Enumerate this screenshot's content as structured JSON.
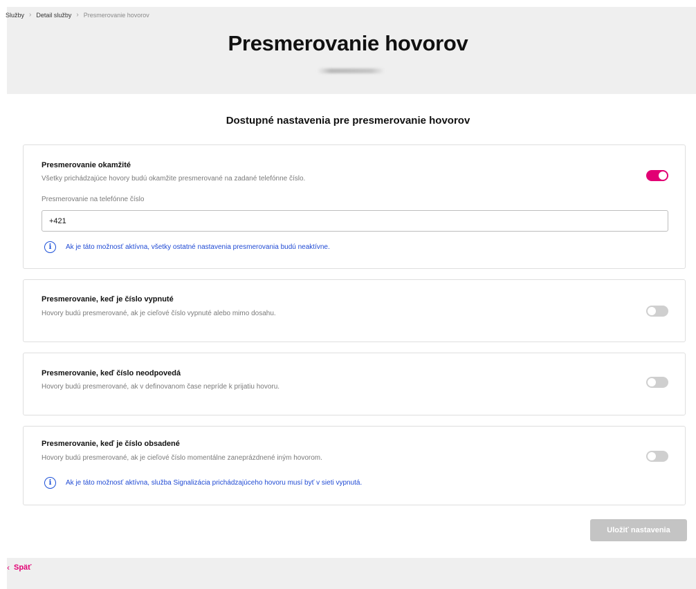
{
  "breadcrumb": {
    "items": [
      "Služby",
      "Detail služby"
    ],
    "current": "Presmerovanie hovorov",
    "separator": "›"
  },
  "page": {
    "title": "Presmerovanie hovorov",
    "section_title": "Dostupné nastavenia pre presmerovanie hovorov"
  },
  "cards": [
    {
      "title": "Presmerovanie okamžité",
      "description": "Všetky prichádzajúce hovory budú okamžite presmerované na zadané telefónne číslo.",
      "enabled": true,
      "field_label": "Presmerovanie na telefónne číslo",
      "field_value": "+421",
      "info": "Ak je táto možnosť aktívna, všetky ostatné nastavenia presmerovania budú neaktívne."
    },
    {
      "title": "Presmerovanie, keď je číslo vypnuté",
      "description": "Hovory budú presmerované, ak je cieľové číslo vypnuté alebo mimo dosahu.",
      "enabled": false
    },
    {
      "title": "Presmerovanie, keď číslo neodpovedá",
      "description": "Hovory budú presmerované, ak v definovanom čase nepríde k prijatiu hovoru.",
      "enabled": false
    },
    {
      "title": "Presmerovanie, keď je číslo obsadené",
      "description": "Hovory budú presmerované, ak je cieľové číslo momentálne zaneprázdnené iným hovorom.",
      "enabled": false,
      "info": "Ak je táto možnosť aktívna, služba Signalizácia prichádzajúceho hovoru musí byť v sieti vypnutá."
    }
  ],
  "actions": {
    "save_label": "Uložiť nastavenia",
    "back_label": "Späť",
    "back_icon": "chevron-left-icon"
  },
  "icons": {
    "info": "info-icon",
    "info_glyph": "i"
  },
  "colors": {
    "accent": "#e20074",
    "info_blue": "#1f4ad4",
    "toggle_off": "#cfcfcf",
    "button_disabled": "#c4c4c4",
    "band": "#efefef"
  }
}
